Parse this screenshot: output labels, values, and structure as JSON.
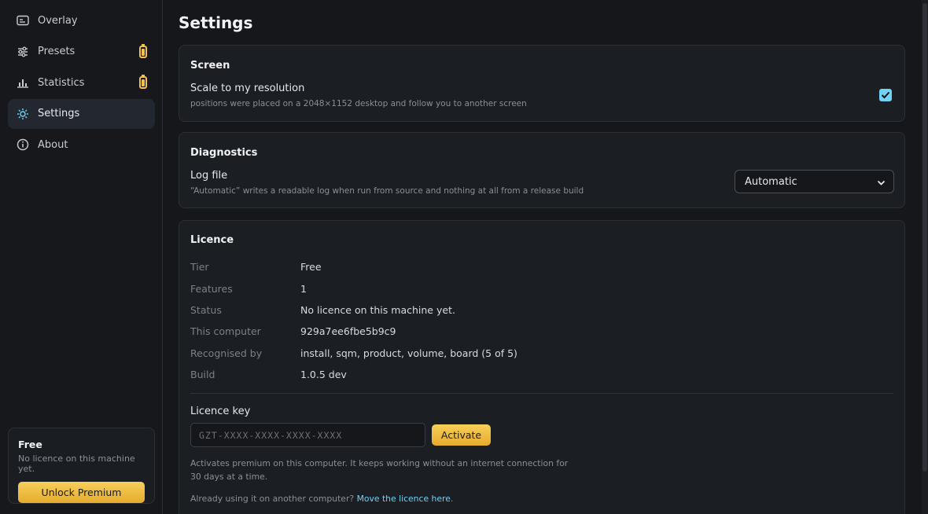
{
  "sidebar": {
    "items": [
      {
        "label": "Overlay",
        "icon": "overlay-icon",
        "locked": false
      },
      {
        "label": "Presets",
        "icon": "sliders-icon",
        "locked": true
      },
      {
        "label": "Statistics",
        "icon": "chart-icon",
        "locked": true
      },
      {
        "label": "Settings",
        "icon": "gear-icon",
        "locked": false,
        "active": true
      },
      {
        "label": "About",
        "icon": "info-icon",
        "locked": false
      }
    ],
    "licence_card": {
      "tier": "Free",
      "status": "No licence on this machine yet.",
      "button": "Unlock Premium"
    }
  },
  "page": {
    "title": "Settings"
  },
  "screen": {
    "heading": "Screen",
    "scale_label": "Scale to my resolution",
    "scale_hint": "positions were placed on a 2048×1152 desktop and follow you to another screen",
    "scale_checked": true
  },
  "diagnostics": {
    "heading": "Diagnostics",
    "log_label": "Log file",
    "log_hint": "“Automatic” writes a readable log when run from source and nothing at all from a release build",
    "log_value": "Automatic"
  },
  "licence": {
    "heading": "Licence",
    "rows": [
      {
        "key": "Tier",
        "value": "Free"
      },
      {
        "key": "Features",
        "value": "1"
      },
      {
        "key": "Status",
        "value": "No licence on this machine yet."
      },
      {
        "key": "This computer",
        "value": "929a7ee6fbe5b9c9"
      },
      {
        "key": "Recognised by",
        "value": "install, sqm, product, volume, board (5 of 5)"
      },
      {
        "key": "Build",
        "value": "1.0.5 dev"
      }
    ],
    "key_label": "Licence key",
    "key_placeholder": "GZT-XXXX-XXXX-XXXX-XXXX",
    "key_value": "",
    "activate": "Activate",
    "note_line1": "Activates premium on this computer. It keeps working without an internet connection for",
    "note_line2": "30 days at a time.",
    "move_prefix": "Already using it on another computer?",
    "move_link": "Move the licence here",
    "move_suffix": "."
  },
  "colors": {
    "accent": "#6fd3f5",
    "premium": "#f2c14e",
    "background": "#15171b"
  }
}
